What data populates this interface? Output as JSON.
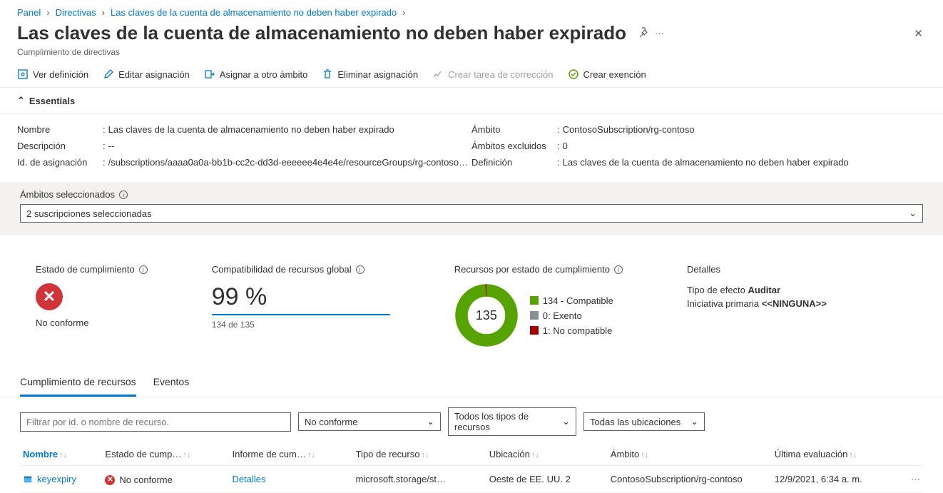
{
  "breadcrumb": [
    "Panel",
    "Directivas",
    "Las claves de la cuenta de almacenamiento no deben haber expirado"
  ],
  "header": {
    "title": "Las claves de la cuenta de almacenamiento no deben haber expirado",
    "subtitle": "Cumplimiento de directivas"
  },
  "toolbar": {
    "view_def": "Ver definición",
    "edit_assign": "Editar asignación",
    "assign_other": "Asignar a otro ámbito",
    "delete_assign": "Eliminar asignación",
    "create_task": "Crear tarea de corrección",
    "create_exempt": "Crear exención"
  },
  "essentials": {
    "toggle_label": "Essentials",
    "left": {
      "name_label": "Nombre",
      "name_value": "Las claves de la cuenta de almacenamiento no deben haber expirado",
      "desc_label": "Descripción",
      "desc_value": "--",
      "assign_id_label": "Id. de asignación",
      "assign_id_value": "/subscriptions/aaaa0a0a-bb1b-cc2c-dd3d-eeeeee4e4e4e/resourceGroups/rg-contoso…"
    },
    "right": {
      "scope_label": "Ámbito",
      "scope_value": "ContosoSubscription/rg-contoso",
      "excl_label": "Ámbitos excluidos",
      "excl_value": "0",
      "def_label": "Definición",
      "def_value": "Las claves de la cuenta de almacenamiento no deben haber expirado"
    }
  },
  "filter_band": {
    "label": "Ámbitos seleccionados",
    "value": "2 suscripciones seleccionadas"
  },
  "cards": {
    "state": {
      "title": "Estado de cumplimiento",
      "value": "No conforme"
    },
    "compat": {
      "title": "Compatibilidad de recursos global",
      "pct": "99 %",
      "detail": "134 de 135"
    },
    "donut": {
      "title": "Recursos por estado de cumplimiento",
      "center": "135",
      "legend": [
        {
          "color": "#57a300",
          "label": "134 - Compatible"
        },
        {
          "color": "#879092",
          "label": "0: Exento"
        },
        {
          "color": "#a80000",
          "label": "1: No compatible"
        }
      ]
    },
    "details": {
      "title": "Detalles",
      "effect_label": "Tipo de efecto",
      "effect_value": "Auditar",
      "parent_label": "Iniciativa primaria",
      "parent_value": "<<NINGUNA>>"
    }
  },
  "tabs": {
    "compliance": "Cumplimiento de recursos",
    "events": "Eventos"
  },
  "grid": {
    "filter_placeholder": "Filtrar por id. o nombre de recurso.",
    "state_filter": "No conforme",
    "type_filter": "Todos los tipos de recursos",
    "loc_filter": "Todas las ubicaciones",
    "cols": {
      "name": "Nombre",
      "state": "Estado de cump…",
      "report": "Informe de cum…",
      "type": "Tipo de recurso",
      "loc": "Ubicación",
      "scope": "Ámbito",
      "last": "Última evaluación"
    },
    "rows": [
      {
        "name": "keyexpiry",
        "state": "No conforme",
        "report": "Detalles",
        "type": "microsoft.storage/st…",
        "loc": "Oeste de EE. UU. 2",
        "scope": "ContosoSubscription/rg-contoso",
        "last": "12/9/2021, 6:34 a. m."
      }
    ]
  }
}
